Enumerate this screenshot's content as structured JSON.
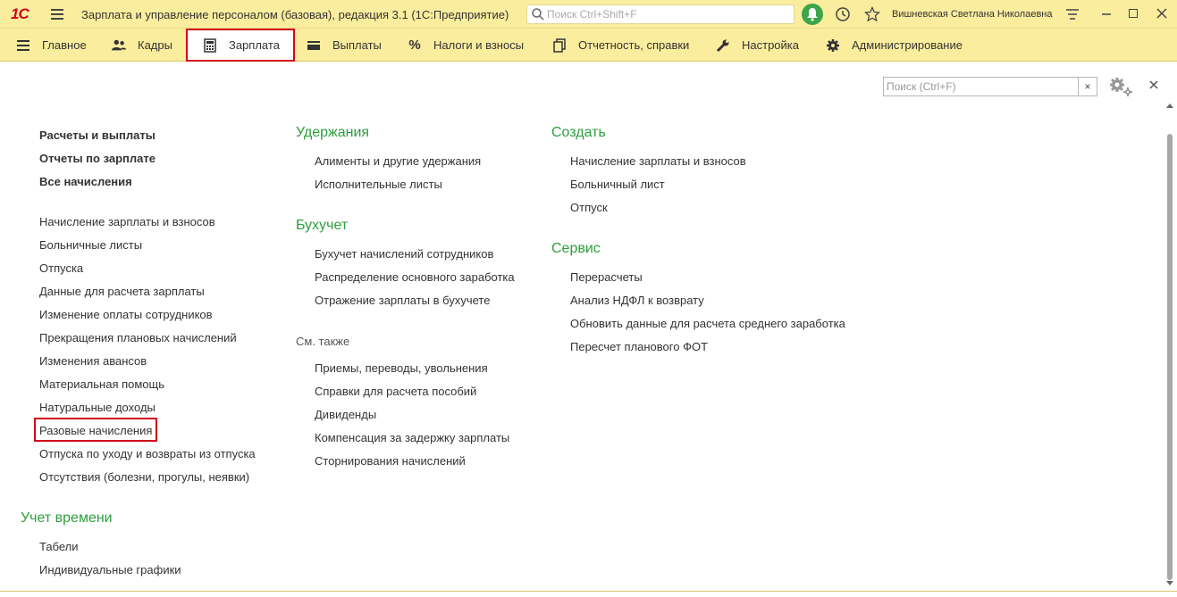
{
  "window": {
    "logo": "1С",
    "title": "Зарплата и управление персоналом (базовая), редакция 3.1  (1С:Предприятие)",
    "search_placeholder": "Поиск Ctrl+Shift+F",
    "user": "Вишневская Светлана Николаевна"
  },
  "menu": {
    "items": [
      {
        "label": "Главное",
        "icon": "hamburger-icon"
      },
      {
        "label": "Кадры",
        "icon": "people-icon"
      },
      {
        "label": "Зарплата",
        "icon": "calculator-icon",
        "active": true
      },
      {
        "label": "Выплаты",
        "icon": "wallet-icon"
      },
      {
        "label": "Налоги и взносы",
        "icon": "percent-icon"
      },
      {
        "label": "Отчетность, справки",
        "icon": "documents-icon"
      },
      {
        "label": "Настройка",
        "icon": "wrench-icon"
      },
      {
        "label": "Администрирование",
        "icon": "gear-icon"
      }
    ]
  },
  "panel": {
    "search_placeholder": "Поиск (Ctrl+F)",
    "clear": "×",
    "close": "×"
  },
  "col1": {
    "bold": [
      "Расчеты и выплаты",
      "Отчеты по зарплате",
      "Все начисления"
    ],
    "links": [
      "Начисление зарплаты и взносов",
      "Больничные листы",
      "Отпуска",
      "Данные для расчета зарплаты",
      "Изменение оплаты сотрудников",
      "Прекращения плановых начислений",
      "Изменения авансов",
      "Материальная помощь",
      "Натуральные доходы",
      "Разовые начисления",
      "Отпуска по уходу и возвраты из отпуска",
      "Отсутствия (болезни, прогулы, неявки)"
    ],
    "time_group": "Учет времени",
    "time_links": [
      "Табели",
      "Индивидуальные графики"
    ]
  },
  "col2": {
    "g1_title": "Удержания",
    "g1_links": [
      "Алименты и другие удержания",
      "Исполнительные листы"
    ],
    "g2_title": "Бухучет",
    "g2_links": [
      "Бухучет начислений сотрудников",
      "Распределение основного заработка",
      "Отражение зарплаты в бухучете"
    ],
    "see_also": "См. также",
    "see_links": [
      "Приемы, переводы, увольнения",
      "Справки для расчета пособий",
      "Дивиденды",
      "Компенсация за задержку зарплаты",
      "Сторнирования начислений"
    ]
  },
  "col3": {
    "g1_title": "Создать",
    "g1_links": [
      "Начисление зарплаты и взносов",
      "Больничный лист",
      "Отпуск"
    ],
    "g2_title": "Сервис",
    "g2_links": [
      "Перерасчеты",
      "Анализ НДФЛ к возврату",
      "Обновить данные для расчета среднего заработка",
      "Пересчет планового ФОТ"
    ]
  },
  "colors": {
    "accent_yellow": "#fbed9e",
    "group_green": "#2ca03c",
    "highlight_red": "#d0021b"
  }
}
